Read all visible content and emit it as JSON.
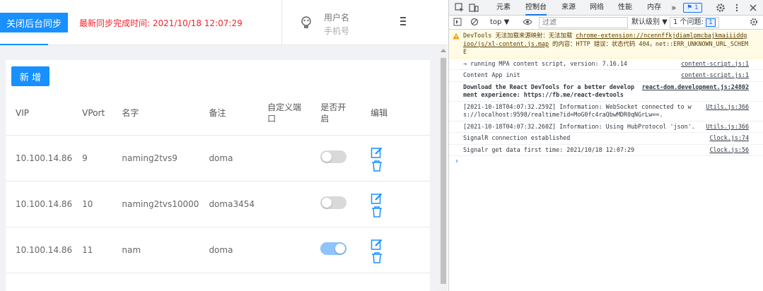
{
  "app": {
    "sync_button": "关闭后台同步",
    "sync_time_label": "最新同步完成时间:  2021/10/18 12:07:29",
    "user": {
      "name": "用户名",
      "phone": "手机号"
    },
    "add_button": "新 增",
    "table": {
      "headers": [
        "VIP",
        "VPort",
        "名字",
        "备注",
        "自定义端口",
        "是否开启",
        "编辑"
      ],
      "rows": [
        {
          "vip": "10.100.14.86",
          "vport": "9",
          "name": "naming2tvs9",
          "note": "doma",
          "custom_port": "",
          "enabled": false
        },
        {
          "vip": "10.100.14.86",
          "vport": "10",
          "name": "naming2tvs10000",
          "note": "doma3454",
          "custom_port": "",
          "enabled": false
        },
        {
          "vip": "10.100.14.86",
          "vport": "11",
          "name": "nam",
          "note": "doma",
          "custom_port": "",
          "enabled": true
        }
      ]
    },
    "colors": {
      "primary": "#1890ff",
      "danger": "#f5222d",
      "switch_on": "#8fc4fb",
      "switch_off": "#d9d9d9"
    }
  },
  "devtools": {
    "tabs": [
      "元素",
      "控制台",
      "来源",
      "网络",
      "性能",
      "内存"
    ],
    "active_tab": "控制台",
    "more_tabs": "»",
    "error_badge": "1",
    "toolbar": {
      "context": "top ▼",
      "filter_placeholder": "过滤",
      "levels": "默认级别 ▼",
      "issues_label": "1 个问题:",
      "issues_count": "1"
    },
    "messages": [
      {
        "type": "warn",
        "text_before": "DevTools 无法加载来源映射：无法加载 ",
        "link": "chrome-extension://ncennffkjdiamlpmcbajkmaiiiddgioo/js/xl-content.js.map",
        "text_after": " 的内容：HTTP 错误：状态代码 404，net::ERR_UNKNOWN_URL_SCHEME",
        "source": ""
      },
      {
        "type": "log",
        "text": "→ running MPA content script, version: 7.16.14",
        "source": "content-script.js:1"
      },
      {
        "type": "log",
        "text": "Content App init",
        "source": "content-script.js:1"
      },
      {
        "type": "log-bold",
        "text": "Download the React DevTools for a better development experience: https://fb.me/react-devtools",
        "source": "react-dom.development.js:24802"
      },
      {
        "type": "log",
        "text": "[2021-10-18T04:07:32.259Z] Information: WebSocket connected to ws://localhost:9598/realtime?id=MoG0fc4raQbwMDR0qNGrLw==.",
        "source": "Utils.js:366"
      },
      {
        "type": "log",
        "text": "[2021-10-18T04:07:32.260Z] Information: Using HubProtocol 'json'.",
        "source": "Utils.js:366"
      },
      {
        "type": "log",
        "text": "SignalR connection established",
        "source": "Clock.js:74"
      },
      {
        "type": "log",
        "text": "Signalr get data first time: 2021/10/18 12:07:29",
        "source": "Clock.js:56"
      }
    ],
    "prompt": "›"
  }
}
